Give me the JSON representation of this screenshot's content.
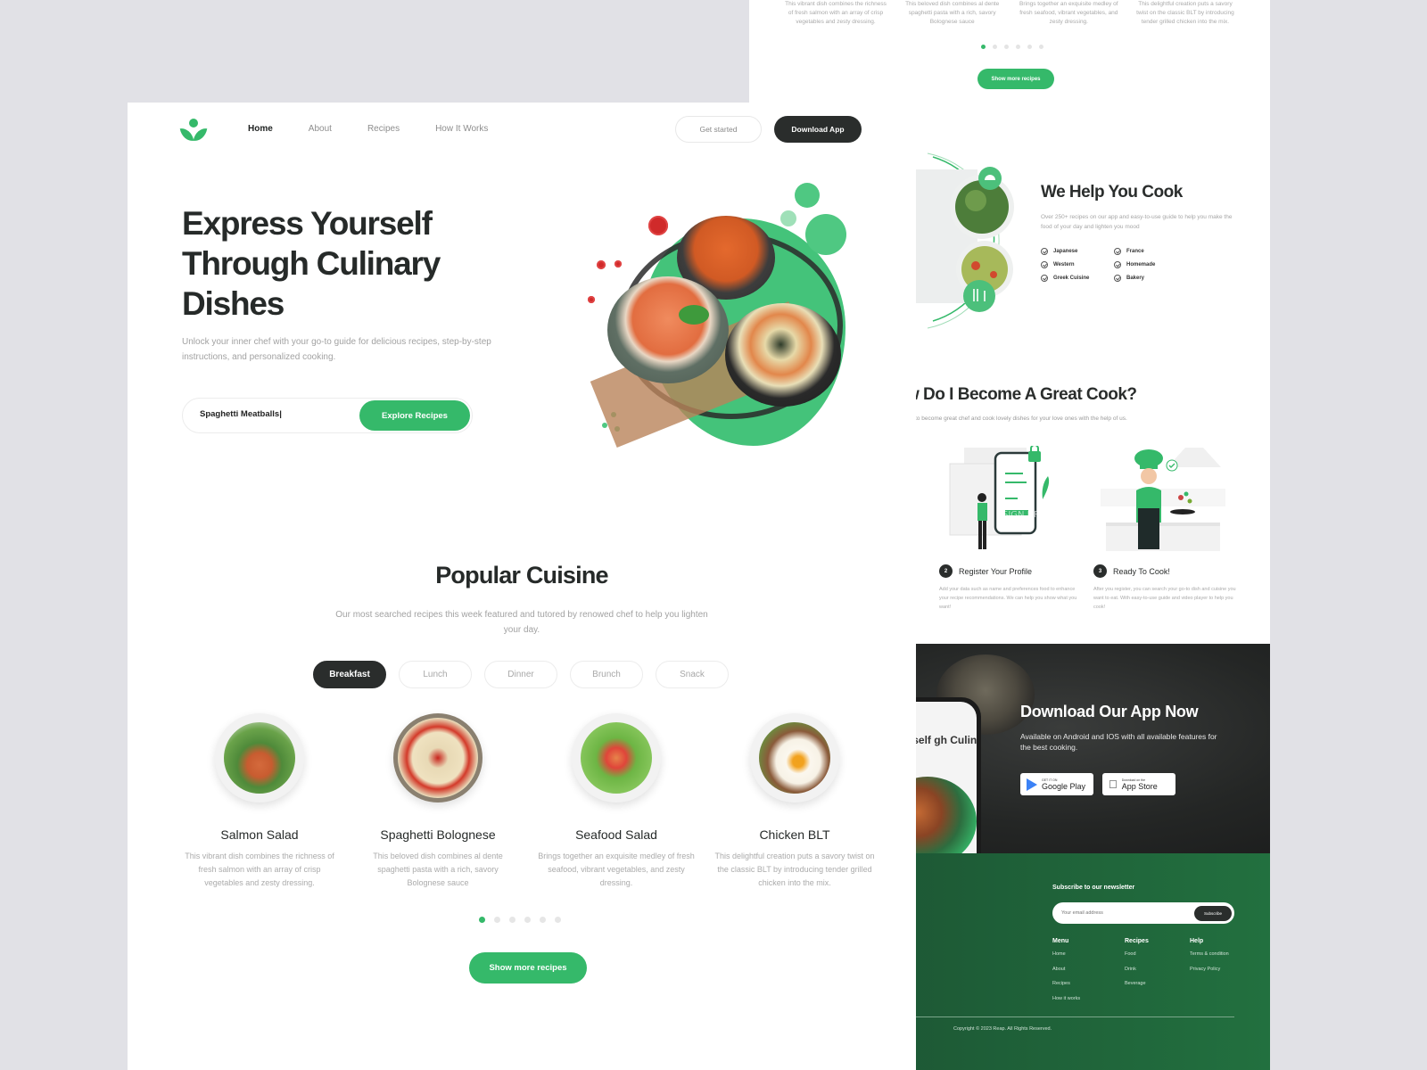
{
  "colors": {
    "accent": "#35b96a",
    "dark": "#2a2d2c",
    "footer_green": "#22703f",
    "muted_text": "#a2a2a2"
  },
  "nav": {
    "logo": "leaf-sprout-logo-icon",
    "links": [
      {
        "label": "Home",
        "active": true
      },
      {
        "label": "About",
        "active": false
      },
      {
        "label": "Recipes",
        "active": false
      },
      {
        "label": "How It Works",
        "active": false
      }
    ],
    "get_started": "Get started",
    "download_app": "Download App"
  },
  "hero": {
    "title": "Express Yourself Through Culinary Dishes",
    "description": "Unlock your inner chef with your go-to guide for delicious recipes, step-by-step instructions, and personalized cooking.",
    "search_value": "Spaghetti Meatballs|",
    "search_button": "Explore Recipes"
  },
  "popular": {
    "title": "Popular Cuisine",
    "subtitle": "Our most searched recipes this week featured and tutored by renowed chef to help you lighten your day.",
    "tabs": [
      {
        "label": "Breakfast",
        "active": true
      },
      {
        "label": "Lunch",
        "active": false
      },
      {
        "label": "Dinner",
        "active": false
      },
      {
        "label": "Brunch",
        "active": false
      },
      {
        "label": "Snack",
        "active": false
      }
    ],
    "cards": [
      {
        "name": "Salmon Salad",
        "description": "This vibrant dish combines the richness of fresh salmon with an array of crisp vegetables and zesty dressing."
      },
      {
        "name": "Spaghetti Bolognese",
        "description": "This beloved dish combines al dente spaghetti pasta with a rich, savory Bolognese sauce"
      },
      {
        "name": "Seafood Salad",
        "description": "Brings together an exquisite medley of fresh seafood, vibrant vegetables, and zesty dressing."
      },
      {
        "name": "Chicken BLT",
        "description": "This delightful creation puts a savory twist on the classic BLT by introducing tender grilled chicken into the mix."
      }
    ],
    "carousel_pages": 6,
    "carousel_active": 1,
    "show_more": "Show more recipes"
  },
  "help": {
    "title": "We Help You Cook",
    "description": "Over 250+ recipes on our app and easy-to-use guide to help you make the food of your day and lighten you mood",
    "cuisines": [
      "Japanese",
      "France",
      "Western",
      "Homemade",
      "Greek Cuisine",
      "Bakery"
    ]
  },
  "become": {
    "title": "w Do I Become A Great Cook?",
    "subtitle": "to become great chef and cook lovely dishes for your love ones with the help of us.",
    "steps": [
      {
        "number": "2",
        "title": "Register Your Profile",
        "description": "Add your data such as name and preferences food to enhance your recipe recommendations. We can help you show what you want!",
        "illustration_text": "SIGN UP"
      },
      {
        "number": "3",
        "title": "Ready To Cook!",
        "description": "After you register, you can search your go-to dish and cuisine you want to eat. With easy-to-use guide and video player to help you cook!"
      }
    ]
  },
  "download": {
    "title": "Download Our App Now",
    "description": "Available on Android and IOS with all available features for the best cooking.",
    "phone_text": "s Yourself gh Culinary",
    "google_small": "GET IT ON",
    "google_big": "Google Play",
    "apple_small": "Download on the",
    "apple_big": "App Store"
  },
  "footer": {
    "newsletter_title": "Subscribe to our newsletter",
    "email_placeholder": "Your email address",
    "subscribe": "Subscribe",
    "columns": [
      {
        "title": "Menu",
        "links": [
          "Home",
          "About",
          "Recipes",
          "How it works"
        ]
      },
      {
        "title": "Recipes",
        "links": [
          "Food",
          "Drink",
          "Beverage"
        ]
      },
      {
        "title": "Help",
        "links": [
          "Terms & condition",
          "Privacy Policy"
        ]
      }
    ],
    "copyright": "Copyright © 2023 Reap. All Rights Reserved."
  }
}
